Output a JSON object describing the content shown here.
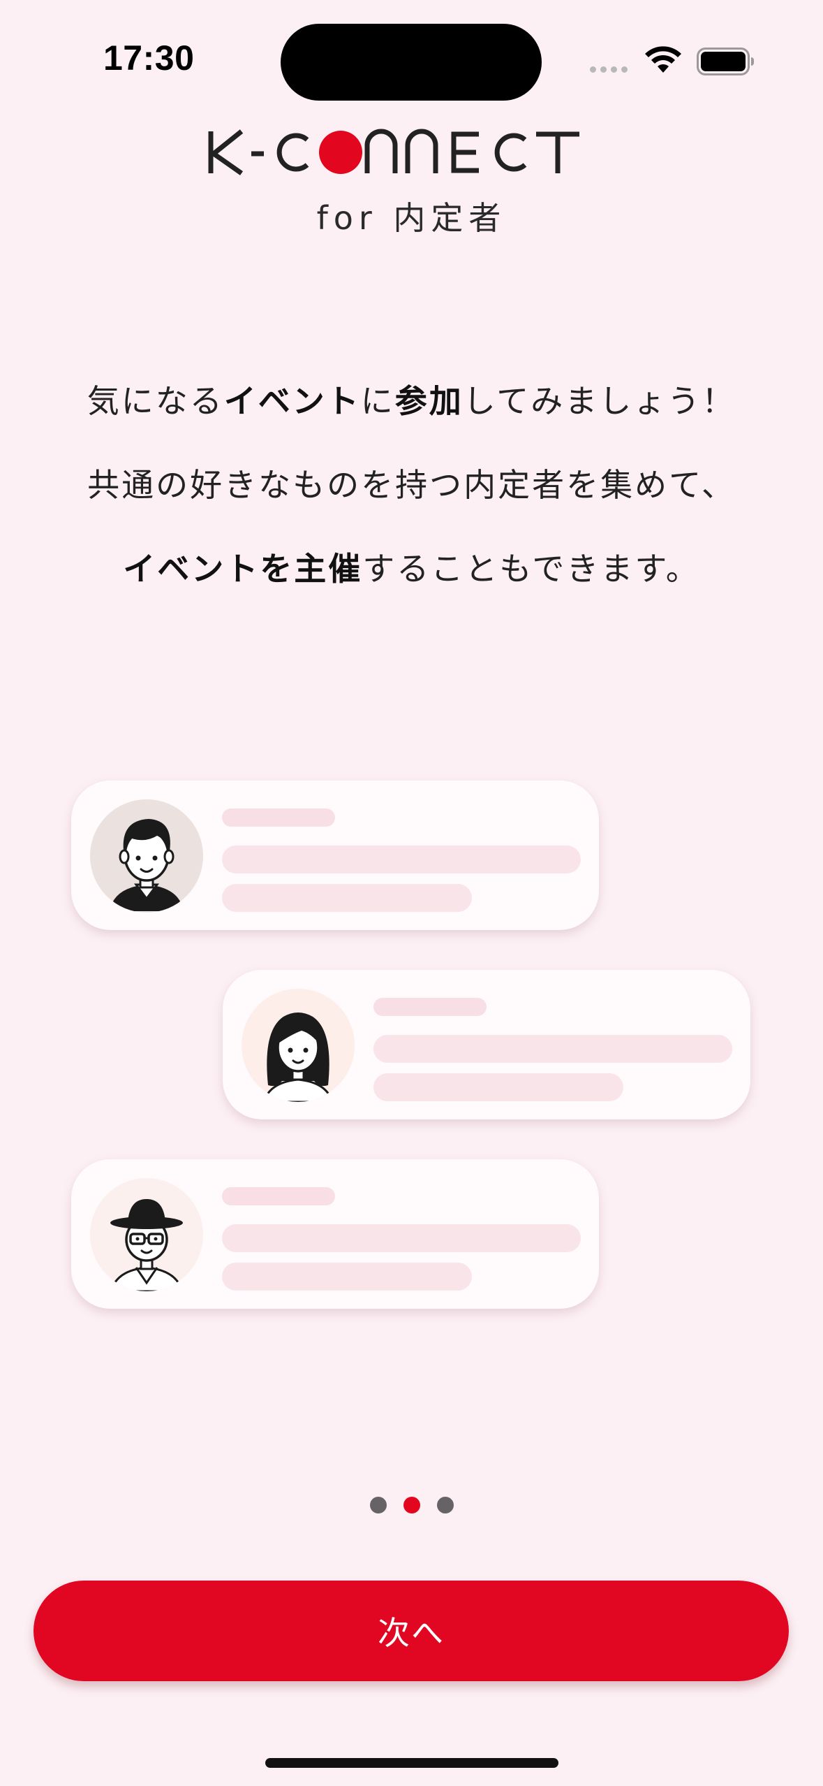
{
  "status_bar": {
    "time": "17:30",
    "icons": [
      "cellular-signal-icon",
      "wifi-icon",
      "battery-icon"
    ]
  },
  "brand": {
    "logo_text": "K-CONNECT",
    "subtitle": "for 内定者",
    "accent_color": "#e2061f"
  },
  "intro": {
    "line1": {
      "pre": "気になる",
      "bold1": "イベント",
      "mid": "に",
      "bold2": "参加",
      "post": "してみましょう！"
    },
    "line2": "共通の好きなものを持つ内定者を集めて、",
    "line3": {
      "bold": "イベントを主催",
      "post": "することもできます。"
    }
  },
  "illustration": {
    "cards": [
      {
        "avatar": "male-avatar-icon",
        "avatar_bg": "#ebe2e0"
      },
      {
        "avatar": "female-avatar-icon",
        "avatar_bg": "#fdeeea"
      },
      {
        "avatar": "hat-glasses-avatar-icon",
        "avatar_bg": "#fbf0ed"
      }
    ]
  },
  "pagination": {
    "total": 3,
    "current": 2
  },
  "next_button": {
    "label": "次へ",
    "color": "#e10622"
  }
}
